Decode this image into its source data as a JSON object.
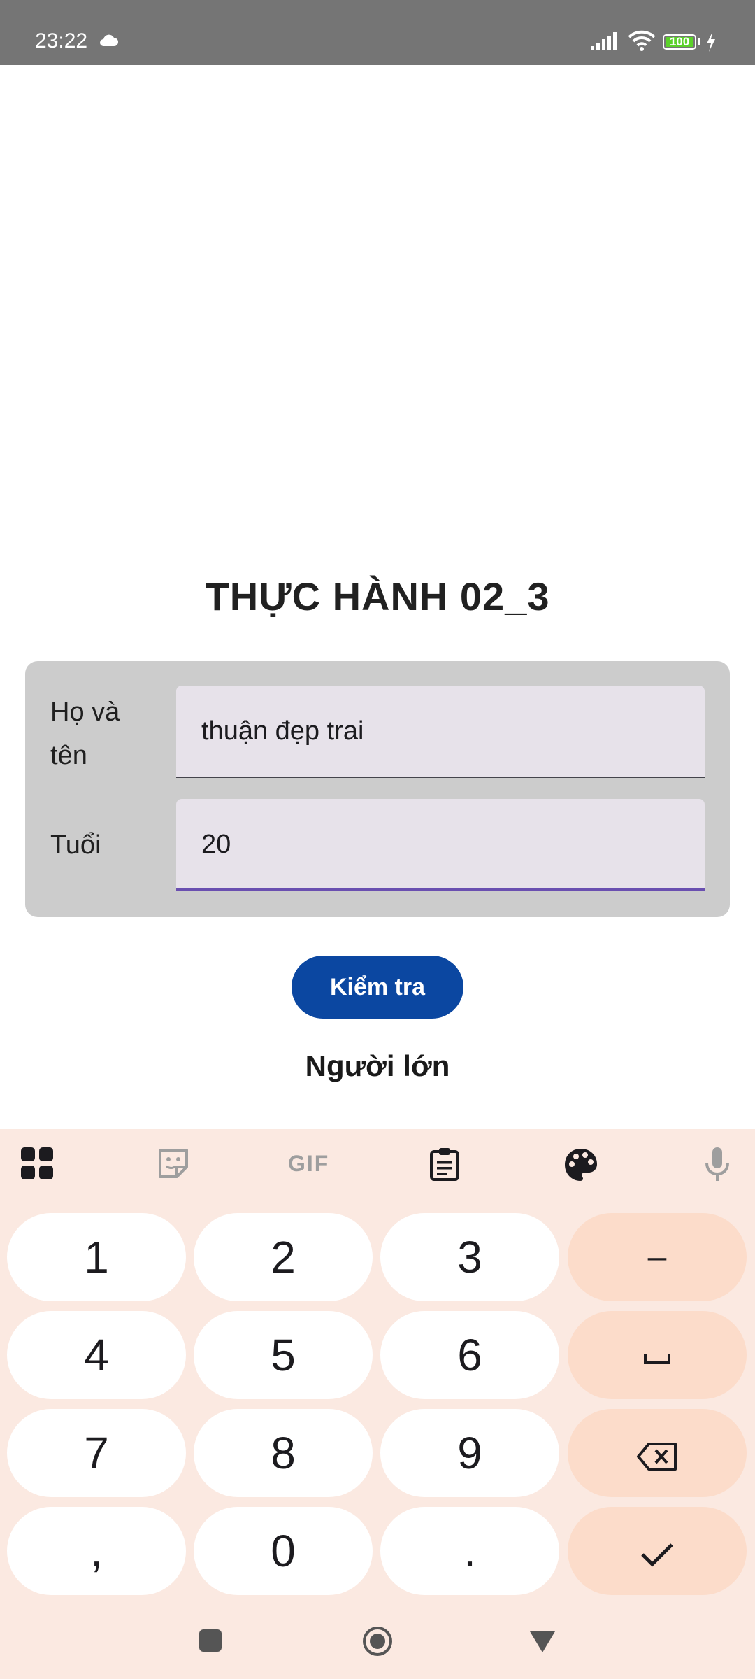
{
  "status_bar": {
    "time": "23:22",
    "battery": "100",
    "icons": [
      "cloud-icon",
      "signal-icon",
      "wifi-icon",
      "battery-icon",
      "charging-icon"
    ]
  },
  "page": {
    "title": "THỰC HÀNH 02_3"
  },
  "form": {
    "name_label": "Họ và tên",
    "name_value": "thuận đẹp trai",
    "age_label": "Tuổi",
    "age_value": "20"
  },
  "check_button": {
    "label": "Kiểm tra"
  },
  "result": {
    "text": "Người lớn"
  },
  "keyboard": {
    "toolbar": [
      "apps-icon",
      "sticker-icon",
      "gif-icon",
      "clipboard-icon",
      "palette-icon",
      "mic-icon"
    ],
    "gif_label": "GIF",
    "keys": {
      "k1": "1",
      "k2": "2",
      "k3": "3",
      "minus": "–",
      "k4": "4",
      "k5": "5",
      "k6": "6",
      "k7": "7",
      "k8": "8",
      "k9": "9",
      "comma": ",",
      "k0": "0",
      "period": "."
    }
  },
  "colors": {
    "status_bar": "#757575",
    "card": "#cccccc",
    "field": "#e7e2ea",
    "field_focus_line": "#6a4fb0",
    "button": "#0b47a1",
    "keyboard_bg": "#fbe9e1",
    "action_key": "#fcdcca"
  }
}
